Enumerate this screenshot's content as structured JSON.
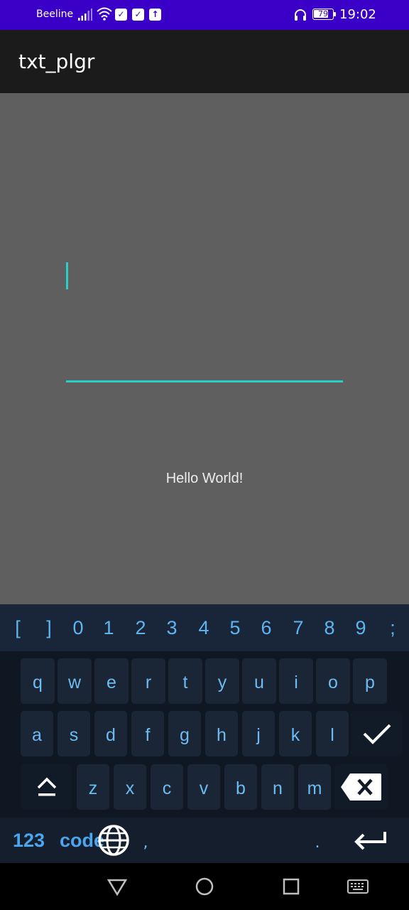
{
  "status_bar": {
    "carrier": "Beeline",
    "battery_level": "79",
    "battery_fraction": 0.79,
    "time": "19:02",
    "icons": [
      "signal-icon",
      "wifi-icon",
      "notification-check-icon",
      "notification-check-icon",
      "upload-icon",
      "headset-icon",
      "battery-icon"
    ]
  },
  "app_bar": {
    "title": "txt_plgr"
  },
  "content": {
    "edit_text_value": "",
    "hello_text": "Hello World!",
    "accent_color": "#2ad0c8"
  },
  "keyboard": {
    "number_row": [
      "[",
      "]",
      "0",
      "1",
      "2",
      "3",
      "4",
      "5",
      "6",
      "7",
      "8",
      "9",
      ";"
    ],
    "row1": [
      "q",
      "w",
      "e",
      "r",
      "t",
      "y",
      "u",
      "i",
      "o",
      "p"
    ],
    "row2": [
      "a",
      "s",
      "d",
      "f",
      "g",
      "h",
      "j",
      "k",
      "l"
    ],
    "row3": [
      "z",
      "x",
      "c",
      "v",
      "b",
      "n",
      "m"
    ],
    "bottom": {
      "numbers_label": "123",
      "code_label": "code",
      "comma_label": ",",
      "period_label": "."
    },
    "key_color": "#6cbbf2"
  },
  "nav_bar": {
    "icons": [
      "back-icon",
      "home-icon",
      "recents-icon",
      "keyboard-switch-icon"
    ]
  }
}
